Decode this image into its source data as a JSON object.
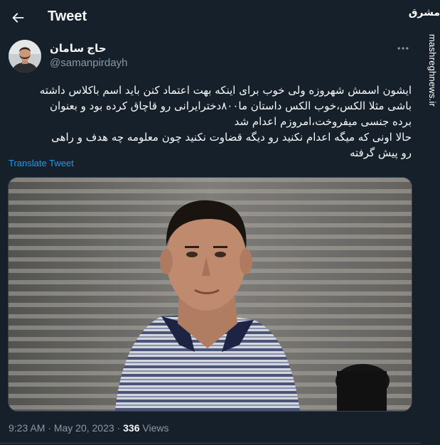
{
  "header": {
    "title": "Tweet"
  },
  "author": {
    "name": "حاج سامان",
    "handle": "@samanpirdayh"
  },
  "tweet": {
    "text": "ایشون اسمش شهروزه ولی خوب برای اینکه بهت اعتماد کنن باید اسم باکلاس داشته\nباشی مثلا الکس،خوب الکس داستان ما۸۰۰دخترایرانی رو قاچاق کرده بود و بعنوان\nبرده جنسی میفروخت،امروزم اعدام شد\nحالا اونی که میگه اعدام نکنید رو دیگه قضاوت نکنید چون معلومه چه هدف و راهی\nرو پیش گرفته",
    "translate_label": "Translate Tweet"
  },
  "meta": {
    "time": "9:23 AM",
    "separator": " · ",
    "date": "May 20, 2023",
    "views_count": "336",
    "views_label": " Views"
  },
  "watermark": {
    "logo": "مشرق",
    "site": "mashreghnews.ir"
  },
  "icons": {
    "back": "arrow-left-icon",
    "more": "more-horizontal-icon"
  },
  "colors": {
    "background": "#15202b",
    "text": "#f7f9f9",
    "secondary": "#8b98a5",
    "link": "#1d9bf0",
    "border": "#38444d"
  }
}
